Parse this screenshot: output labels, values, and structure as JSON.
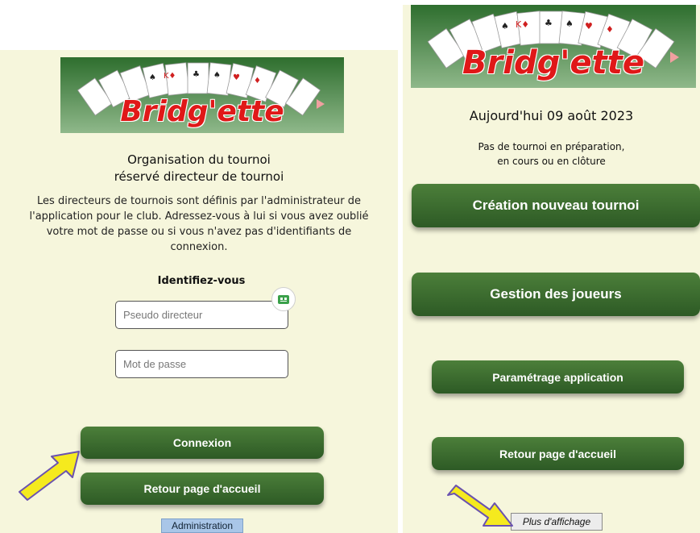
{
  "left": {
    "logo_text": "Bridg'ette",
    "heading_line1": "Organisation du tournoi",
    "heading_line2": "réservé directeur de tournoi",
    "info_line1": "Les directeurs de tournois sont définis par l'administrateur de",
    "info_line2": "l'application pour le club. Adressez-vous à lui si vous avez oublié",
    "info_line3": "votre mot de passe ou si vous n'avez pas d'identifiants de",
    "info_line4": "connexion.",
    "identify_label": "Identifiez-vous",
    "pseudo_placeholder": "Pseudo directeur",
    "password_placeholder": "Mot de passe",
    "connexion_label": "Connexion",
    "retour_label": "Retour page d'accueil",
    "admin_label": "Administration"
  },
  "right": {
    "logo_text": "Bridg'ette",
    "date_text": "Aujourd'hui 09 août 2023",
    "status_line1": "Pas de tournoi en préparation,",
    "status_line2": "en cours ou en clôture",
    "create_label": "Création nouveau tournoi",
    "players_label": "Gestion des joueurs",
    "settings_label": "Paramétrage application",
    "retour_label": "Retour page d'accueil",
    "more_label": "Plus d'affichage"
  },
  "colors": {
    "panel_bg": "#f6f6dc",
    "button_green": "#3d6e30",
    "logo_red": "#e01818",
    "arrow_yellow": "#f5ea1e"
  }
}
